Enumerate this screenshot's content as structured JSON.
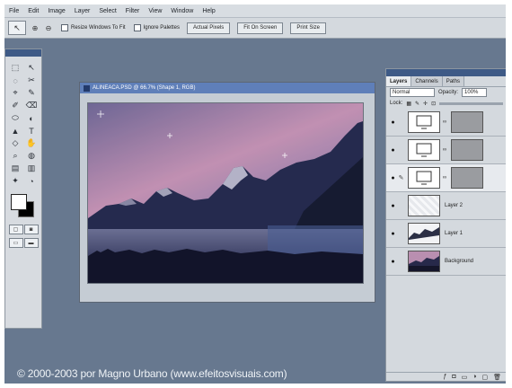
{
  "menu": [
    "File",
    "Edit",
    "Image",
    "Layer",
    "Select",
    "Filter",
    "View",
    "Window",
    "Help"
  ],
  "options": {
    "tool_glyph": "↖",
    "checkbox_1": "Resize Windows To Fit",
    "checkbox_2": "Ignore Palettes",
    "btn_actual": "Actual Pixels",
    "btn_fit": "Fit On Screen",
    "btn_print": "Print Size"
  },
  "toolbox": {
    "tools": [
      "⬚",
      "↖",
      "◌",
      "✂",
      "⌖",
      "✎",
      "✐",
      "⌫",
      "⬭",
      "◐",
      "▲",
      "T",
      "◇",
      "✋",
      "⌕",
      "◍",
      "▤",
      "▥",
      "✦",
      "◔"
    ],
    "mode_a": "▢",
    "mode_b": "◙",
    "screen_a": "▭",
    "screen_b": "▬",
    "foreground_color": "#ffffff",
    "background_color": "#000000"
  },
  "document": {
    "title": "ALINEACA.PSD @ 66.7% (Shape 1, RGB)"
  },
  "layers_panel": {
    "tabs": [
      "Layers",
      "Channels",
      "Paths"
    ],
    "blend_mode": "Normal",
    "opacity_label": "Opacity:",
    "opacity_value": "100%",
    "lock_label": "Lock:",
    "layers": [
      {
        "name": "",
        "type": "shape",
        "selected": false
      },
      {
        "name": "",
        "type": "shape",
        "selected": false
      },
      {
        "name": "",
        "type": "shape",
        "selected": true
      },
      {
        "name": "Layer 2",
        "type": "light",
        "selected": false
      },
      {
        "name": "Layer 1",
        "type": "ridge",
        "selected": false
      },
      {
        "name": "Background",
        "type": "bg",
        "selected": false
      }
    ]
  },
  "copyright": "© 2000-2003 por Magno Urbano (www.efeitosvisuais.com)"
}
